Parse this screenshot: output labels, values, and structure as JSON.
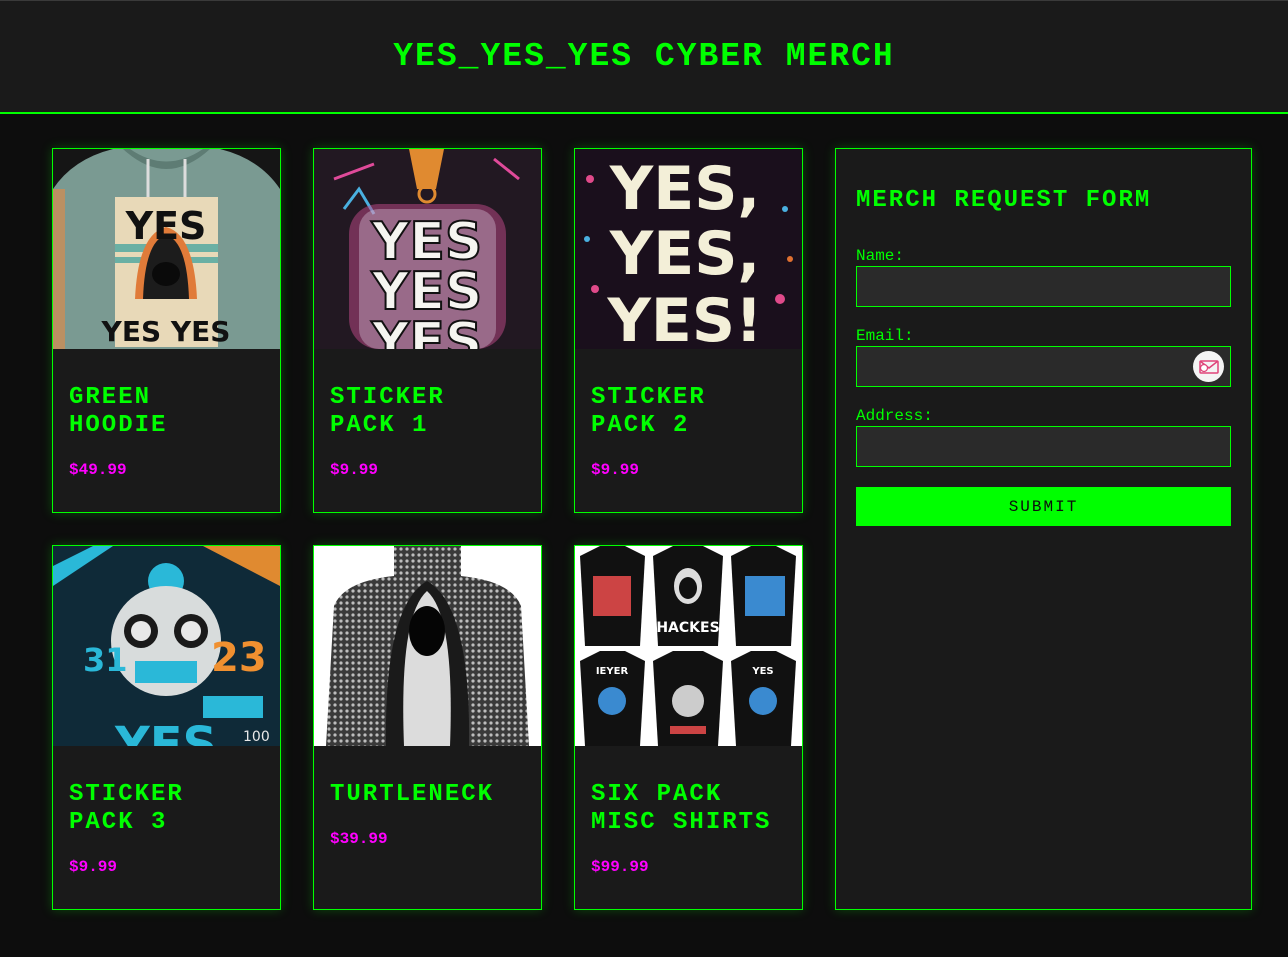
{
  "header": {
    "title": "YES_YES_YES CYBER MERCH"
  },
  "products": [
    {
      "name": "GREEN HOODIE",
      "price": "$49.99",
      "image": "green-hoodie-image"
    },
    {
      "name": "STICKER PACK 1",
      "price": "$9.99",
      "image": "sticker-pack-1-image"
    },
    {
      "name": "STICKER PACK 2",
      "price": "$9.99",
      "image": "sticker-pack-2-image"
    },
    {
      "name": "STICKER PACK 3",
      "price": "$9.99",
      "image": "sticker-pack-3-image"
    },
    {
      "name": "TURTLENECK",
      "price": "$39.99",
      "image": "turtleneck-image"
    },
    {
      "name": "SIX PACK MISC SHIRTS",
      "price": "$99.99",
      "image": "six-pack-shirts-image"
    }
  ],
  "form": {
    "title": "MERCH REQUEST FORM",
    "name_label": "Name:",
    "name_value": "",
    "email_label": "Email:",
    "email_value": "",
    "address_label": "Address:",
    "address_value": "",
    "submit_label": "SUBMIT"
  },
  "colors": {
    "accent": "#00ff00",
    "price": "#ff00ff",
    "background": "#0d0d0d",
    "panel": "#1a1a1a"
  },
  "image_text": {
    "hoodie_top": "YES",
    "hoodie_bottom": "YES YES",
    "sticker1": "YES",
    "sticker2": "YES,",
    "sticker3_a": "31",
    "sticker3_b": "23",
    "sticker3_c": "YES",
    "sticker3_d": "100",
    "shirts_hackes": "HACKES",
    "shirts_ieyer": "IEYER",
    "shirts_yes": "YES"
  }
}
